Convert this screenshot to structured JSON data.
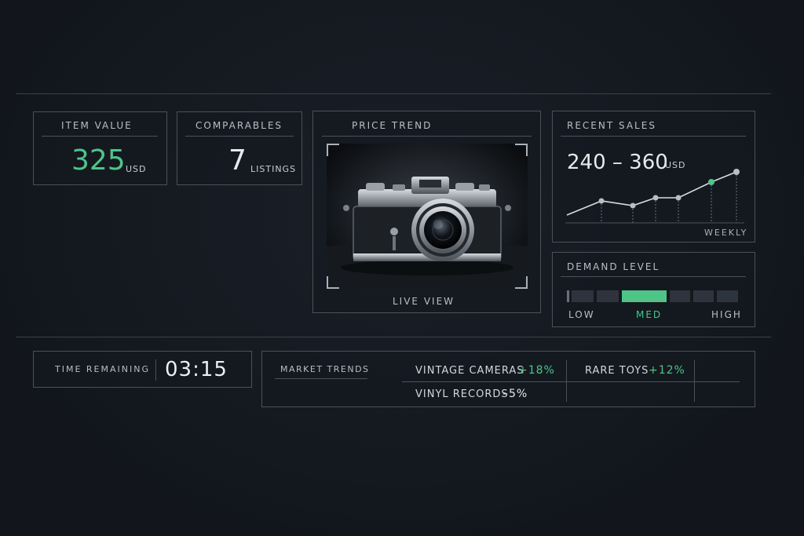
{
  "item_value": {
    "label": "ITEM VALUE",
    "value": "325",
    "unit": "USD"
  },
  "comparables": {
    "label": "COMPARABLES",
    "value": "7",
    "unit": "LISTINGS"
  },
  "price_trend": {
    "label": "PRICE TREND",
    "caption": "LIVE VIEW"
  },
  "recent_sales": {
    "label": "RECENT SALES",
    "range": "240 – 360",
    "unit": "USD",
    "period": "WEEKLY"
  },
  "demand": {
    "label": "DEMAND LEVEL",
    "low": "LOW",
    "med": "MED",
    "high": "HIGH",
    "level": "med"
  },
  "timer": {
    "label": "TIME REMAINING",
    "value": "03:15"
  },
  "market_trends": {
    "label": "MARKET TRENDS",
    "items": [
      {
        "name": "VINTAGE CAMERAS",
        "change": "+18%"
      },
      {
        "name": "RARE TOYS",
        "change": "+12%"
      },
      {
        "name": "VINYL RECORDS",
        "change": "–5%"
      }
    ]
  },
  "colors": {
    "accent": "#4ec489",
    "border": "#4a515b",
    "background": "#141920"
  }
}
